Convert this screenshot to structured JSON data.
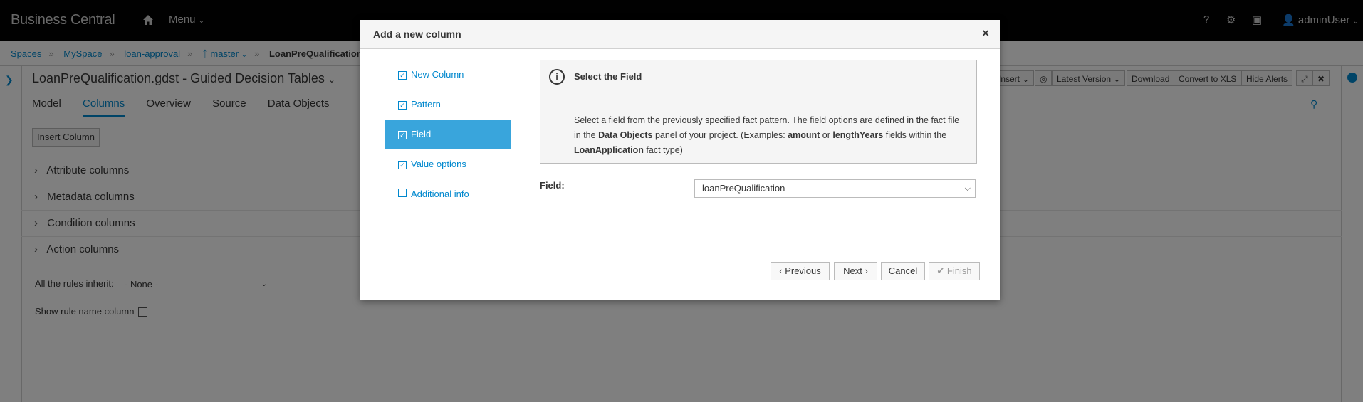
{
  "nav": {
    "brand": "Business Central",
    "menu_label": "Menu",
    "help_label": "?",
    "user_label": "adminUser"
  },
  "breadcrumb": {
    "items": [
      "Spaces",
      "MySpace",
      "loan-approval",
      "master"
    ],
    "current": "LoanPreQualification"
  },
  "editor": {
    "title": "LoanPreQualification.gdst - Guided Decision Tables",
    "tabs": [
      "Model",
      "Columns",
      "Overview",
      "Source",
      "Data Objects"
    ],
    "active_tab": "Columns",
    "insert_column_label": "Insert Column",
    "sections": [
      "Attribute columns",
      "Metadata columns",
      "Condition columns",
      "Action columns"
    ],
    "inherit_label": "All the rules inherit:",
    "inherit_value": "- None -",
    "rule_name_label": "Show rule name column",
    "toolbar": [
      "Insert",
      "Latest Version",
      "Download",
      "Convert to XLS",
      "Hide Alerts"
    ]
  },
  "modal": {
    "title": "Add a new column",
    "close": "×",
    "steps": [
      {
        "label": "New Column",
        "checked": true
      },
      {
        "label": "Pattern",
        "checked": true
      },
      {
        "label": "Field",
        "checked": true
      },
      {
        "label": "Value options",
        "checked": true
      },
      {
        "label": "Additional info",
        "checked": false
      }
    ],
    "active_step": "Field",
    "info": {
      "title": "Select the Field",
      "text_1": "Select a field from the previously specified fact pattern. The field options are defined in the fact file in the ",
      "text_bold_1": "Data Objects",
      "text_2": " panel of your project. (Examples: ",
      "text_bold_2": "amount",
      "text_3": " or ",
      "text_bold_3": "lengthYears",
      "text_4": " fields within the ",
      "text_bold_4": "LoanApplication",
      "text_5": " fact type)"
    },
    "field_label": "Field:",
    "field_value": "loanPreQualification",
    "buttons": {
      "previous": "Previous",
      "next": "Next",
      "cancel": "Cancel",
      "finish": "Finish"
    }
  }
}
